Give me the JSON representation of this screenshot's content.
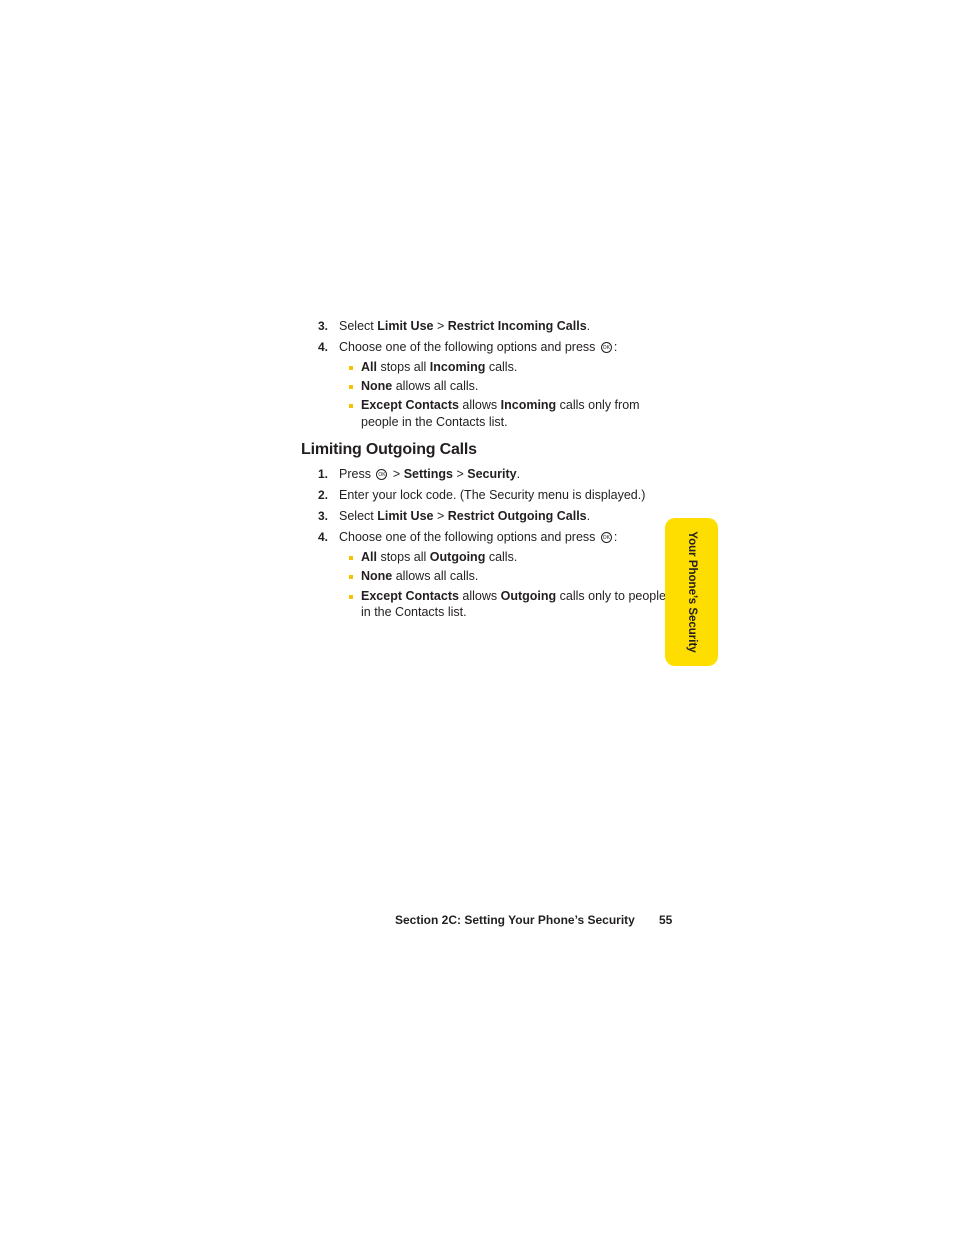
{
  "incoming": {
    "steps": [
      {
        "num": "3.",
        "pre": "Select ",
        "b1": "Limit Use",
        "mid": " > ",
        "b2": "Restrict Incoming Calls",
        "post": "."
      },
      {
        "num": "4.",
        "text": "Choose one of the following options and press ",
        "post": ":"
      }
    ],
    "options": [
      {
        "b1": "All",
        "t1": " stops all ",
        "b2": "Incoming",
        "t2": " calls."
      },
      {
        "b1": "None",
        "t1": " allows all calls."
      },
      {
        "b1": "Except Contacts",
        "t1": " allows ",
        "b2": "Incoming",
        "t2": " calls only from",
        "line2": "people in the Contacts list."
      }
    ]
  },
  "outgoing": {
    "heading": "Limiting Outgoing Calls",
    "steps": [
      {
        "num": "1.",
        "pre": "Press ",
        "mid": " > ",
        "b1": "Settings",
        "mid2": " > ",
        "b2": "Security",
        "post": "."
      },
      {
        "num": "2.",
        "text": "Enter your lock code. (The Security menu is displayed.)"
      },
      {
        "num": "3.",
        "pre": "Select ",
        "b1": "Limit Use",
        "mid": " > ",
        "b2": "Restrict Outgoing Calls",
        "post": "."
      },
      {
        "num": "4.",
        "text": "Choose one of the following options and press ",
        "post": ":"
      }
    ],
    "options": [
      {
        "b1": "All",
        "t1": " stops all ",
        "b2": "Outgoing",
        "t2": " calls."
      },
      {
        "b1": "None",
        "t1": " allows all calls."
      },
      {
        "b1": "Except Contacts",
        "t1": " allows ",
        "b2": "Outgoing",
        "t2": " calls only to people",
        "line2": "in the Contacts list."
      }
    ]
  },
  "ok_icon_label": "OK",
  "side_tab": {
    "label": "Your Phone’s Security",
    "color": "#fedd00"
  },
  "footer": {
    "section": "Section 2C: Setting Your Phone’s Security",
    "page": "55"
  },
  "bullet_color": "#f5c400"
}
